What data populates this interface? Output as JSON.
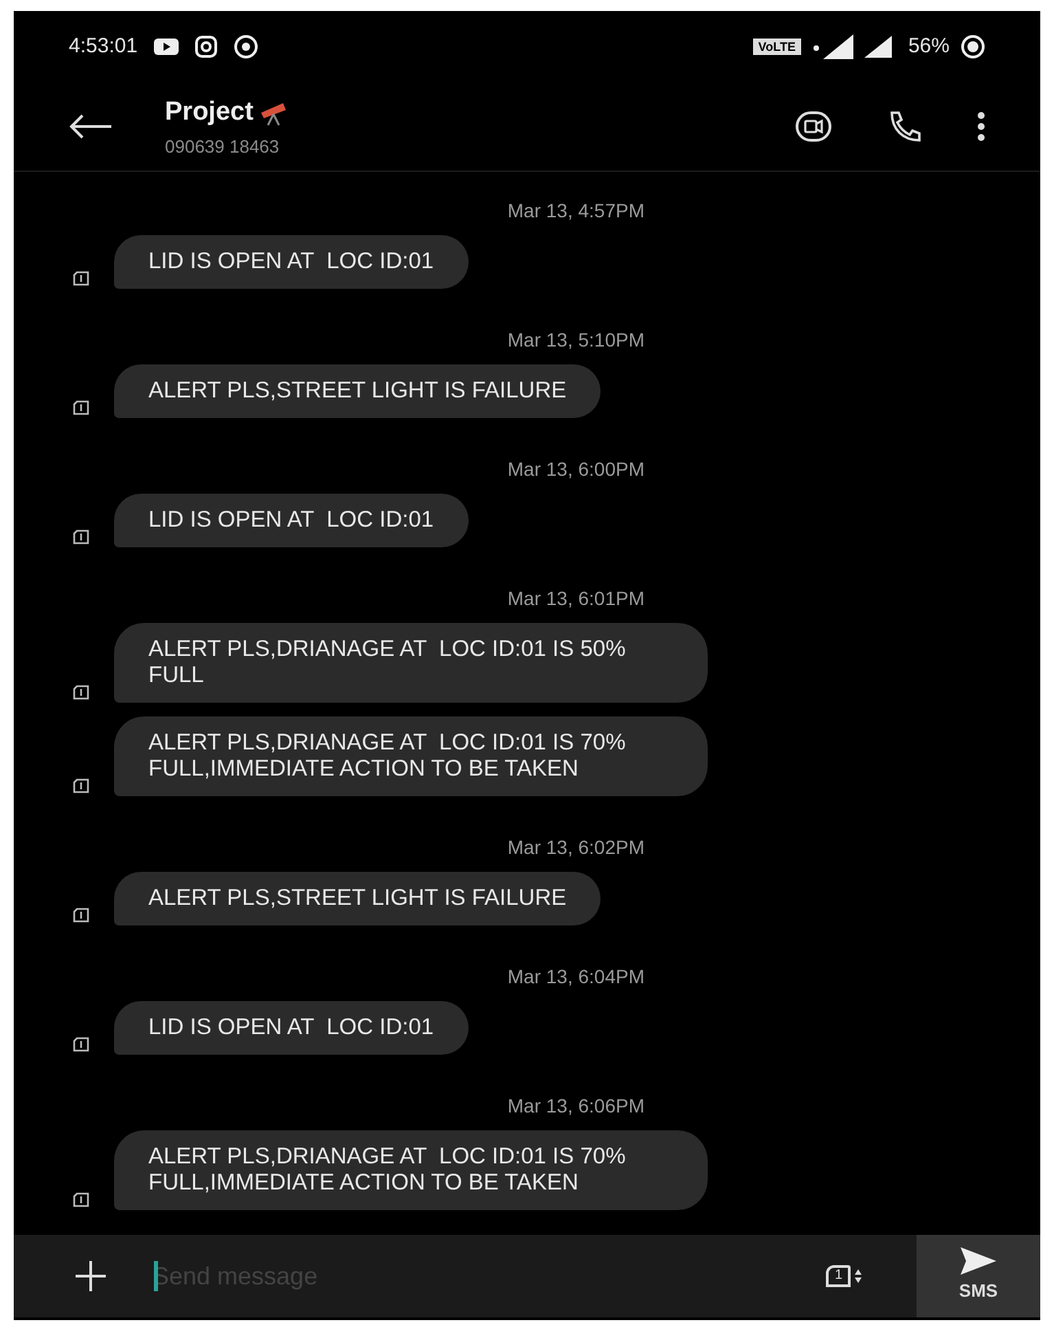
{
  "status_bar": {
    "time": "4:53:01",
    "network": "VoLTE",
    "battery": "56%"
  },
  "header": {
    "title": "Project",
    "subtitle": "090639 18463"
  },
  "thread": [
    {
      "kind": "time",
      "text": "Mar 13, 4:57PM"
    },
    {
      "kind": "message",
      "text": "LID IS OPEN AT  LOC ID:01"
    },
    {
      "kind": "time",
      "text": "Mar 13, 5:10PM"
    },
    {
      "kind": "message",
      "text": "ALERT PLS,STREET LIGHT IS FAILURE"
    },
    {
      "kind": "time",
      "text": "Mar 13, 6:00PM"
    },
    {
      "kind": "message",
      "text": "LID IS OPEN AT  LOC ID:01"
    },
    {
      "kind": "time",
      "text": "Mar 13, 6:01PM"
    },
    {
      "kind": "message",
      "text": "ALERT PLS,DRIANAGE AT  LOC ID:01 IS 50% FULL"
    },
    {
      "kind": "message",
      "text": "ALERT PLS,DRIANAGE AT  LOC ID:01 IS 70% FULL,IMMEDIATE ACTION TO BE TAKEN"
    },
    {
      "kind": "time",
      "text": "Mar 13, 6:02PM"
    },
    {
      "kind": "message",
      "text": "ALERT PLS,STREET LIGHT IS FAILURE"
    },
    {
      "kind": "time",
      "text": "Mar 13, 6:04PM"
    },
    {
      "kind": "message",
      "text": "LID IS OPEN AT  LOC ID:01"
    },
    {
      "kind": "time",
      "text": "Mar 13, 6:06PM"
    },
    {
      "kind": "message",
      "text": "ALERT PLS,DRIANAGE AT  LOC ID:01 IS 70% FULL,IMMEDIATE ACTION TO BE TAKEN"
    }
  ],
  "composer": {
    "placeholder": "Send message",
    "sim": "1",
    "send_label": "SMS"
  }
}
